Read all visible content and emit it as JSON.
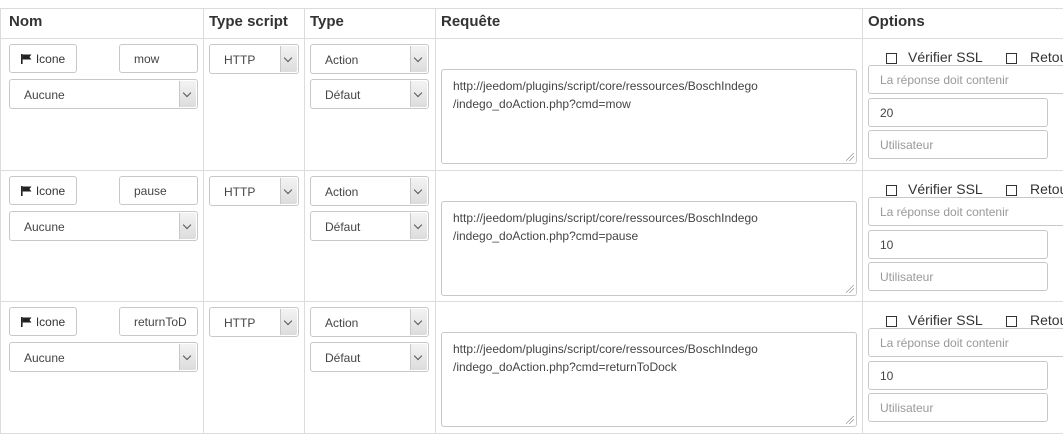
{
  "headers": {
    "nom": "Nom",
    "type_script": "Type script",
    "type": "Type",
    "requete": "Requête",
    "options": "Options"
  },
  "rows": [
    {
      "icon_button": "Icone",
      "name": "mow",
      "icon_select": "Aucune",
      "script_type": "HTTP",
      "type": "Action",
      "subtype": "Défaut",
      "request_line1": "http://jeedom/plugins/script/core/ressources/BoschIndego",
      "request_line2": "/indego_doAction.php?cmd=mow",
      "verify_ssl": "Vérifier SSL",
      "retour": "Retou",
      "response_placeholder": "La réponse doit contenir",
      "timeout": "20",
      "user_placeholder": "Utilisateur"
    },
    {
      "icon_button": "Icone",
      "name": "pause",
      "icon_select": "Aucune",
      "script_type": "HTTP",
      "type": "Action",
      "subtype": "Défaut",
      "request_line1": "http://jeedom/plugins/script/core/ressources/BoschIndego",
      "request_line2": "/indego_doAction.php?cmd=pause",
      "verify_ssl": "Vérifier SSL",
      "retour": "Retou",
      "response_placeholder": "La réponse doit contenir",
      "timeout": "10",
      "user_placeholder": "Utilisateur"
    },
    {
      "icon_button": "Icone",
      "name": "returnToD",
      "icon_select": "Aucune",
      "script_type": "HTTP",
      "type": "Action",
      "subtype": "Défaut",
      "request_line1": "http://jeedom/plugins/script/core/ressources/BoschIndego",
      "request_line2": "/indego_doAction.php?cmd=returnToDock",
      "verify_ssl": "Vérifier SSL",
      "retour": "Retou",
      "response_placeholder": "La réponse doit contenir",
      "timeout": "10",
      "user_placeholder": "Utilisateur"
    }
  ]
}
